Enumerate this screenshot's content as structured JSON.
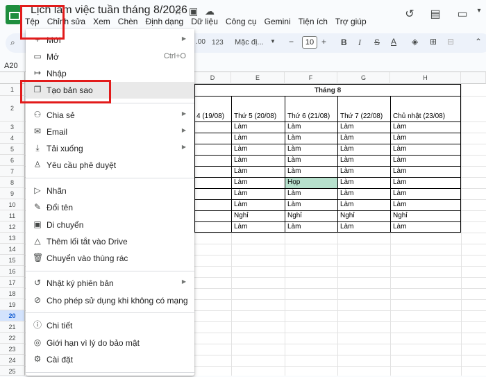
{
  "doc_title": "Lịch làm việc tuần tháng 8/2026",
  "menubar": [
    "Tệp",
    "Chỉnh sửa",
    "Xem",
    "Chèn",
    "Định dạng",
    "Dữ liệu",
    "Công cụ",
    "Gemini",
    "Tiện ích",
    "Trợ giúp"
  ],
  "toolbar": {
    "zoom_partial": ".00",
    "num_format": "123",
    "font": "Mặc đị...",
    "font_size": "10"
  },
  "name_box": "A20",
  "columns": [
    "D",
    "E",
    "F",
    "G",
    "H"
  ],
  "rows": [
    "1",
    "2",
    "3",
    "4",
    "5",
    "6",
    "7",
    "8",
    "9",
    "10",
    "11",
    "12",
    "13",
    "14",
    "15",
    "16",
    "17",
    "18",
    "19",
    "20",
    "21",
    "22",
    "23",
    "24",
    "25"
  ],
  "sheet": {
    "title": "Tháng 8",
    "headers": [
      "4 (19/08)",
      "Thứ 5 (20/08)",
      "Thứ 6 (21/08)",
      "Thứ 7 (22/08)",
      "Chủ nhật (23/08)"
    ],
    "data": [
      [
        "Làm",
        "Làm",
        "Làm",
        "Làm"
      ],
      [
        "Làm",
        "Làm",
        "Làm",
        "Làm"
      ],
      [
        "Làm",
        "Làm",
        "Làm",
        "Làm"
      ],
      [
        "Làm",
        "Làm",
        "Làm",
        "Làm"
      ],
      [
        "Làm",
        "Làm",
        "Làm",
        "Làm"
      ],
      [
        "Làm",
        "Họp",
        "Làm",
        "Làm"
      ],
      [
        "Làm",
        "Làm",
        "Làm",
        "Làm"
      ],
      [
        "Làm",
        "Làm",
        "Làm",
        "Làm"
      ],
      [
        "Nghỉ",
        "Nghỉ",
        "Nghỉ",
        "Nghỉ"
      ],
      [
        "Làm",
        "Làm",
        "Làm",
        "Làm"
      ]
    ]
  },
  "file_menu": {
    "items": [
      {
        "label": "Mới",
        "icon": "plus-icon",
        "arrow": true
      },
      {
        "label": "Mở",
        "icon": "folder-icon",
        "shortcut": "Ctrl+O"
      },
      {
        "label": "Nhập",
        "icon": "import-icon"
      },
      {
        "label": "Tạo bản sao",
        "icon": "copy-icon"
      },
      {
        "label": "Chia sẻ",
        "icon": "share-person-icon",
        "arrow": true
      },
      {
        "label": "Email",
        "icon": "mail-icon",
        "arrow": true
      },
      {
        "label": "Tải xuống",
        "icon": "download-icon",
        "arrow": true
      },
      {
        "label": "Yêu cầu phê duyệt",
        "icon": "approval-icon"
      },
      {
        "label": "Nhãn",
        "icon": "label-icon"
      },
      {
        "label": "Đổi tên",
        "icon": "pencil-icon"
      },
      {
        "label": "Di chuyển",
        "icon": "move-folder-icon"
      },
      {
        "label": "Thêm lối tắt vào Drive",
        "icon": "drive-shortcut-icon"
      },
      {
        "label": "Chuyển vào thùng rác",
        "icon": "trash-icon"
      },
      {
        "label": "Nhật ký phiên bản",
        "icon": "history-icon",
        "arrow": true
      },
      {
        "label": "Cho phép sử dụng khi không có mạng",
        "icon": "offline-icon"
      },
      {
        "label": "Chi tiết",
        "icon": "info-icon"
      },
      {
        "label": "Giới hạn vì lý do bảo mật",
        "icon": "security-icon"
      },
      {
        "label": "Cài đặt",
        "icon": "gear-icon"
      }
    ]
  },
  "colors": {
    "accent_red": "#e21b1b",
    "highlight_green": "#b7e1cd",
    "menu_hover": "#e9e9e9",
    "selected_row": "#d3e3fd"
  }
}
